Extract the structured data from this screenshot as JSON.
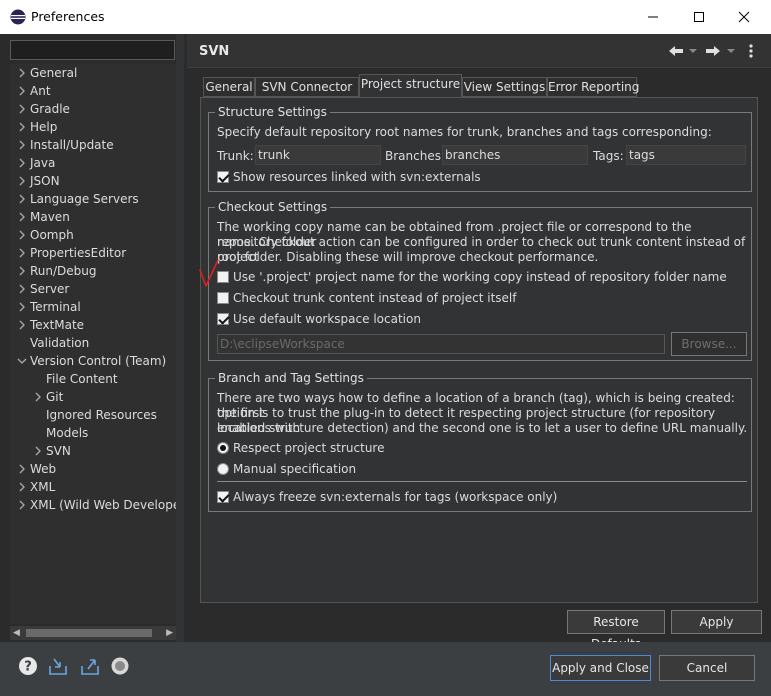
{
  "window": {
    "title": "Preferences",
    "controls": {
      "minimize_icon": "minimize-icon",
      "maximize_icon": "maximize-icon",
      "close_icon": "close-icon"
    }
  },
  "sidebar": {
    "filter_placeholder": "",
    "tree": [
      {
        "label": "General",
        "level": 0,
        "expander": "collapsed"
      },
      {
        "label": "Ant",
        "level": 0,
        "expander": "collapsed"
      },
      {
        "label": "Gradle",
        "level": 0,
        "expander": "collapsed"
      },
      {
        "label": "Help",
        "level": 0,
        "expander": "collapsed"
      },
      {
        "label": "Install/Update",
        "level": 0,
        "expander": "collapsed"
      },
      {
        "label": "Java",
        "level": 0,
        "expander": "collapsed"
      },
      {
        "label": "JSON",
        "level": 0,
        "expander": "collapsed"
      },
      {
        "label": "Language Servers",
        "level": 0,
        "expander": "collapsed"
      },
      {
        "label": "Maven",
        "level": 0,
        "expander": "collapsed"
      },
      {
        "label": "Oomph",
        "level": 0,
        "expander": "collapsed"
      },
      {
        "label": "PropertiesEditor",
        "level": 0,
        "expander": "collapsed"
      },
      {
        "label": "Run/Debug",
        "level": 0,
        "expander": "collapsed"
      },
      {
        "label": "Server",
        "level": 0,
        "expander": "collapsed"
      },
      {
        "label": "Terminal",
        "level": 0,
        "expander": "collapsed"
      },
      {
        "label": "TextMate",
        "level": 0,
        "expander": "collapsed"
      },
      {
        "label": "Validation",
        "level": 0,
        "expander": "none"
      },
      {
        "label": "Version Control (Team)",
        "level": 0,
        "expander": "expanded"
      },
      {
        "label": "File Content",
        "level": 1,
        "expander": "none"
      },
      {
        "label": "Git",
        "level": 1,
        "expander": "collapsed"
      },
      {
        "label": "Ignored Resources",
        "level": 1,
        "expander": "none"
      },
      {
        "label": "Models",
        "level": 1,
        "expander": "none"
      },
      {
        "label": "SVN",
        "level": 1,
        "expander": "collapsed"
      },
      {
        "label": "Web",
        "level": 0,
        "expander": "collapsed"
      },
      {
        "label": "XML",
        "level": 0,
        "expander": "collapsed"
      },
      {
        "label": "XML (Wild Web Developer)",
        "level": 0,
        "expander": "collapsed"
      }
    ]
  },
  "page": {
    "title": "SVN",
    "header_icons": [
      "back-arrow-icon",
      "back-menu-icon",
      "forward-arrow-icon",
      "forward-menu-icon",
      "view-menu-icon"
    ]
  },
  "tabs": [
    {
      "label": "General",
      "active": false
    },
    {
      "label": "SVN Connector",
      "active": false
    },
    {
      "label": "Project structure",
      "active": true
    },
    {
      "label": "View Settings",
      "active": false
    },
    {
      "label": "Error Reporting",
      "active": false
    }
  ],
  "structure": {
    "legend": "Structure Settings",
    "description": "Specify default repository root names for trunk, branches and tags corresponding:",
    "trunk_label": "Trunk:",
    "trunk_value": "trunk",
    "branches_label": "Branches:",
    "branches_value": "branches",
    "tags_label": "Tags:",
    "tags_value": "tags",
    "show_externals_label": "Show resources linked with svn:externals",
    "show_externals_checked": true
  },
  "checkout": {
    "legend": "Checkout Settings",
    "description_lines": [
      "The working copy name can be obtained from .project file or correspond to the repository folder",
      "name. Checkout action can be configured in order to check out trunk content instead of project",
      "root folder. Disabling these will improve checkout performance."
    ],
    "use_project_name_label": "Use '.project' project name for the working copy instead of repository folder name",
    "use_project_name_checked": false,
    "checkout_trunk_label": "Checkout trunk content instead of project itself",
    "checkout_trunk_checked": false,
    "use_default_workspace_label": "Use default workspace location",
    "use_default_workspace_checked": true,
    "workspace_path": "D:\\eclipseWorkspace",
    "browse_label": "Browse..."
  },
  "branch_tag": {
    "legend": "Branch and Tag Settings",
    "description_lines": [
      "There are two ways how to define a location of a branch (tag), which is being created: the first",
      "option is to trust the plug-in to detect it respecting project structure (for repository locations with",
      "enabled structure detection) and the second one is to let a user to define URL manually."
    ],
    "respect_label": "Respect project structure",
    "respect_checked": true,
    "manual_label": "Manual specification",
    "manual_checked": false,
    "freeze_label": "Always freeze svn:externals for tags (workspace only)",
    "freeze_checked": true
  },
  "buttons": {
    "restore_defaults": "Restore Defaults",
    "apply": "Apply",
    "apply_and_close": "Apply and Close",
    "cancel": "Cancel"
  },
  "footer_icons": [
    "help-icon",
    "import-icon",
    "export-icon",
    "oomph-icon"
  ],
  "colors": {
    "accent": "#4a8cd6",
    "annotation": "#e02020"
  }
}
